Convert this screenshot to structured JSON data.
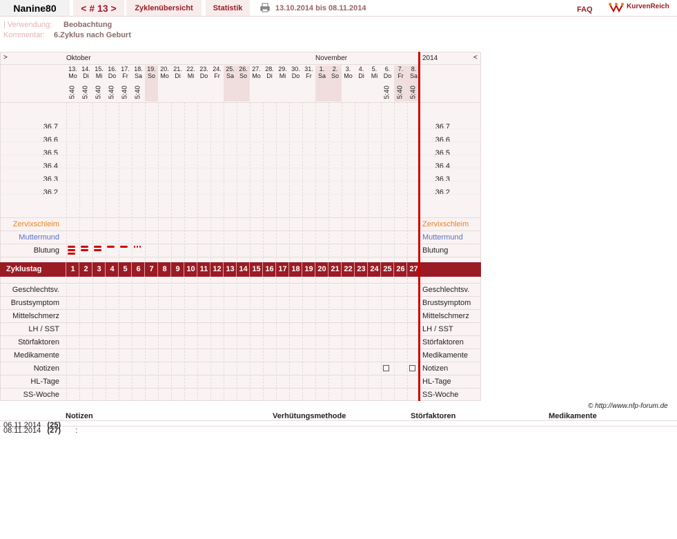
{
  "header": {
    "user": "Nanine80",
    "cycle": "< # 13 >",
    "overview": "Zyklenübersicht",
    "stats": "Statistik",
    "range": "13.10.2014 bis 08.11.2014",
    "faq": "FAQ",
    "logo": "KurvenReich"
  },
  "meta": {
    "usage_label": "| Verwendung:",
    "usage_value": "Beobachtung",
    "comment_label": "Kommentar:",
    "comment_value": "6.Zyklus nach Geburt"
  },
  "chart": {
    "nav_left": ">",
    "nav_right": "<",
    "month1": "Oktober",
    "month2": "November",
    "year": "2014",
    "days": [
      {
        "d": "13.",
        "w": "Mo",
        "t": "5:40"
      },
      {
        "d": "14.",
        "w": "Di",
        "t": "5:40"
      },
      {
        "d": "15.",
        "w": "Mi",
        "t": "5:40"
      },
      {
        "d": "16.",
        "w": "Do",
        "t": "5:40"
      },
      {
        "d": "17.",
        "w": "Fr",
        "t": "5:40"
      },
      {
        "d": "18.",
        "w": "Sa",
        "t": "5:40"
      },
      {
        "d": "19.",
        "w": "So",
        "t": ""
      },
      {
        "d": "20.",
        "w": "Mo",
        "t": ""
      },
      {
        "d": "21.",
        "w": "Di",
        "t": ""
      },
      {
        "d": "22.",
        "w": "Mi",
        "t": ""
      },
      {
        "d": "23.",
        "w": "Do",
        "t": ""
      },
      {
        "d": "24.",
        "w": "Fr",
        "t": ""
      },
      {
        "d": "25.",
        "w": "Sa",
        "t": ""
      },
      {
        "d": "26.",
        "w": "So",
        "t": ""
      },
      {
        "d": "27.",
        "w": "Mo",
        "t": ""
      },
      {
        "d": "28.",
        "w": "Di",
        "t": ""
      },
      {
        "d": "29.",
        "w": "Mi",
        "t": ""
      },
      {
        "d": "30.",
        "w": "Do",
        "t": ""
      },
      {
        "d": "31.",
        "w": "Fr",
        "t": ""
      },
      {
        "d": "1.",
        "w": "Sa",
        "t": ""
      },
      {
        "d": "2.",
        "w": "So",
        "t": ""
      },
      {
        "d": "3.",
        "w": "Mo",
        "t": ""
      },
      {
        "d": "4.",
        "w": "Di",
        "t": ""
      },
      {
        "d": "5.",
        "w": "Mi",
        "t": ""
      },
      {
        "d": "6.",
        "w": "Do",
        "t": "5:40"
      },
      {
        "d": "7.",
        "w": "Fr",
        "t": "5:40"
      },
      {
        "d": "8.",
        "w": "Sa",
        "t": "5:40"
      }
    ],
    "temps": [
      "36.7",
      "36.6",
      "36.5",
      "36.4",
      "36.3",
      "36.2"
    ],
    "rows_top": [
      "Zervixschleim",
      "Muttermund",
      "Blutung"
    ],
    "cycle_label": "Zyklustag",
    "cycle_days": [
      "1",
      "2",
      "3",
      "4",
      "5",
      "6",
      "7",
      "8",
      "9",
      "10",
      "11",
      "12",
      "13",
      "14",
      "15",
      "16",
      "17",
      "18",
      "19",
      "20",
      "21",
      "22",
      "23",
      "24",
      "25",
      "26",
      "27"
    ],
    "rows_bottom": [
      "Geschlechtsv.",
      "Brustsymptom",
      "Mittelschmerz",
      "LH / SST",
      "Störfaktoren",
      "Medikamente",
      "Notizen",
      "HL-Tage",
      "SS-Woche"
    ],
    "copyright": "© http://www.nfp-forum.de"
  },
  "notes_table": {
    "headers": [
      "Notizen",
      "Verhütungsmethode",
      "Störfaktoren",
      "Medikamente"
    ],
    "rows": [
      {
        "date": "06.11.2014",
        "day": "(25)",
        "text": ""
      },
      {
        "date": "08.11.2014",
        "day": "(27)",
        "text": ":"
      }
    ]
  },
  "colors": {
    "accent": "#9b1b24",
    "zervix": "#e8821e",
    "muttermund": "#5a6fc7",
    "bleeding": "#cc0000"
  }
}
